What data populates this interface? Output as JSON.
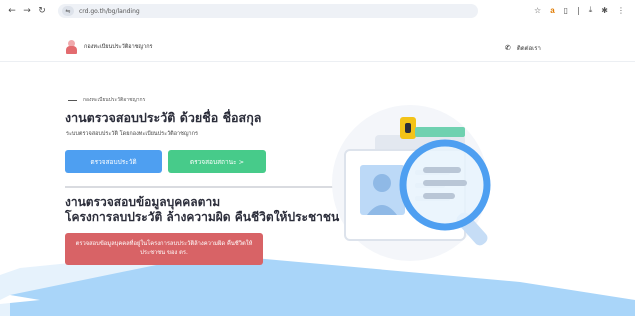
{
  "browser": {
    "url": "crd.go.th/bg/landing",
    "back_icon": "arrow-left-icon",
    "forward_icon": "arrow-right-icon",
    "reload_icon": "reload-icon",
    "site_info_icon": "tune-icon",
    "right_icons": [
      "star-icon",
      "amazon-icon",
      "note-icon",
      "download-icon",
      "extension-icon",
      "more-icon"
    ]
  },
  "header": {
    "org_name": "กองทะเบียนประวัติอาชญากร",
    "contact_label": "ติดต่อเรา"
  },
  "hero": {
    "kicker": "กองทะเบียนประวัติอาชญากร",
    "title": "งานตรวจสอบประวัติ ด้วยชื่อ ชื่อสกุล",
    "subtitle": "ระบบตรวจสอบประวัติ โดยกองทะเบียนประวัติอาชญากร",
    "btn_check": "ตรวจสอบประวัติ",
    "btn_status": "ตรวจสอบสถานะ >"
  },
  "section2": {
    "title_line1": "งานตรวจสอบข้อมูลบุคคลตาม",
    "title_line2": "โครงการลบประวัติ ล้างความผิด คืนชีวิตให้ประชาชน",
    "btn_label": "ตรวจสอบข้อมูลบุคคลที่อยู่ในโครงการลบประวัติล้างความผิด คืนชีวิตให้ประชาชน ของ ตร."
  },
  "colors": {
    "blue": "#4e9ff1",
    "green": "#47cb8a",
    "red": "#d86366",
    "logo_pink": "#e36b6f"
  }
}
